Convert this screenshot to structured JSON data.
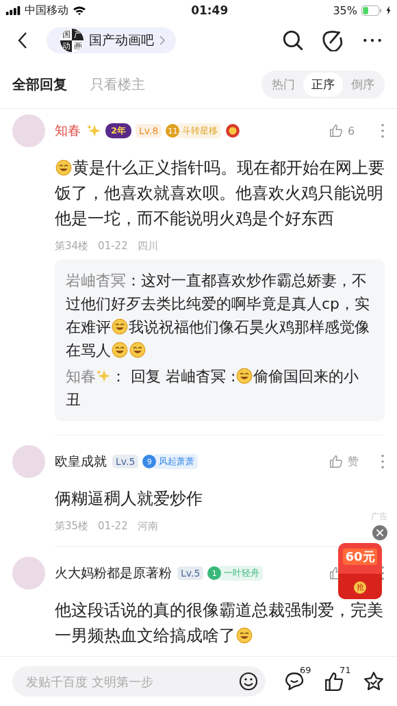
{
  "status_bar": {
    "carrier": "中国移动",
    "time": "01:49",
    "battery": "35%"
  },
  "nav": {
    "forum": "国产动画吧",
    "logo_chars": [
      "国",
      "产",
      "动",
      "画"
    ]
  },
  "tabs": [
    {
      "label": "全部回复",
      "selected": true
    },
    {
      "label": "只看楼主",
      "selected": false
    }
  ],
  "sort": [
    {
      "label": "热门",
      "selected": false
    },
    {
      "label": "正序",
      "selected": true
    },
    {
      "label": "倒序",
      "selected": false
    }
  ],
  "comments": [
    {
      "author": "知春",
      "author_sparkle": true,
      "vip": true,
      "badges": [
        {
          "kind": "tenure",
          "text": "2年",
          "color": "#5a2a8a"
        },
        {
          "kind": "level",
          "text": "Lv.8",
          "color": "#e8902a"
        },
        {
          "kind": "title",
          "num": "11",
          "text": "斗转星移",
          "color": "#e0a020"
        },
        {
          "kind": "medal",
          "color": "#d83a2a"
        }
      ],
      "likes": "6",
      "body": [
        {
          "kind": "emoji"
        },
        {
          "kind": "text",
          "text": "黄是什么正义指针吗。现在都开始在网上要饭了，他喜欢就喜欢呗。他喜欢火鸡只能说明他是一坨，而不能说明火鸡是个好东西"
        }
      ],
      "floor": "第34楼",
      "date": "01-22",
      "place": "四川",
      "replies": [
        {
          "author": "岩岫杳冥",
          "sparkle": false,
          "body": [
            {
              "kind": "text",
              "text": "：这对一直都喜欢炒作霸总娇妻，不过他们好歹去类比纯爱的啊毕竟是真人cp，实在难评"
            },
            {
              "kind": "emoji"
            },
            {
              "kind": "text",
              "text": "我说祝福他们像石昊火鸡那样感觉像在骂人"
            },
            {
              "kind": "emoji"
            },
            {
              "kind": "emoji"
            }
          ]
        },
        {
          "author": "知春",
          "sparkle": true,
          "body": [
            {
              "kind": "text",
              "text": "： 回复 岩岫杳冥 :"
            },
            {
              "kind": "emoji"
            },
            {
              "kind": "text",
              "text": "偷偷国回来的小丑"
            }
          ]
        }
      ]
    },
    {
      "author": "欧皇成就",
      "author_sparkle": false,
      "vip": false,
      "badges": [
        {
          "kind": "level",
          "text": "Lv.5",
          "color": "#4a6a9a"
        },
        {
          "kind": "title",
          "num": "9",
          "text": "风起萧萧",
          "color": "#3a8ae8"
        }
      ],
      "likes": "赞",
      "body": [
        {
          "kind": "text",
          "text": "俩糊逼稠人就爱炒作"
        }
      ],
      "floor": "第35楼",
      "date": "01-22",
      "place": "河南"
    },
    {
      "author": "火大妈粉都是原著粉",
      "author_sparkle": false,
      "vip": false,
      "badges": [
        {
          "kind": "level",
          "text": "Lv.5",
          "color": "#4a6a9a"
        },
        {
          "kind": "title",
          "num": "1",
          "text": "一叶轻舟",
          "color": "#3ab87a"
        }
      ],
      "body": [
        {
          "kind": "text",
          "text": "他这段话说的真的很像霸道总裁强制爱，完美一男频热血文给搞成啥了"
        },
        {
          "kind": "emoji"
        }
      ]
    }
  ],
  "ad": {
    "label": "广告",
    "amount": "60元",
    "action": "抢"
  },
  "bottom_bar": {
    "placeholder": "发贴千百度 文明第一步",
    "comments": "69",
    "likes": "71"
  }
}
